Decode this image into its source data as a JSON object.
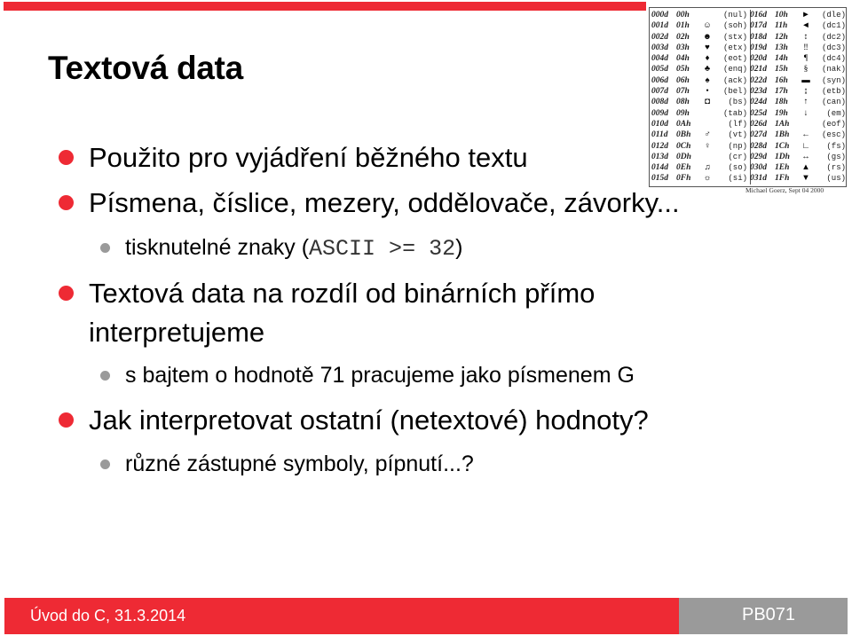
{
  "slide": {
    "title": "Textová data",
    "bullets": [
      {
        "text": "Použito pro vyjádření běžného textu"
      },
      {
        "text": "Písmena, číslice, mezery, oddělovače, závorky...",
        "sub": [
          {
            "prefix": "tisknutelné znaky (",
            "code": "ASCII >= 32",
            "suffix": ")"
          }
        ]
      },
      {
        "text_line1": "Textová data na rozdíl od binárních přímo",
        "text_line2": "interpretujeme",
        "sub": [
          {
            "text": "s bajtem o hodnotě 71 pracujeme jako písmenem G"
          }
        ]
      },
      {
        "text": "Jak interpretovat ostatní (netextové) hodnoty?",
        "sub": [
          {
            "text": "různé zástupné symboly, pípnutí...?"
          }
        ]
      }
    ]
  },
  "ascii_table": {
    "left": [
      {
        "dec": "000d",
        "hex": "00h",
        "sym": "",
        "name": "(nul)"
      },
      {
        "dec": "001d",
        "hex": "01h",
        "sym": "☺",
        "name": "(soh)"
      },
      {
        "dec": "002d",
        "hex": "02h",
        "sym": "☻",
        "name": "(stx)"
      },
      {
        "dec": "003d",
        "hex": "03h",
        "sym": "♥",
        "name": "(etx)"
      },
      {
        "dec": "004d",
        "hex": "04h",
        "sym": "♦",
        "name": "(eot)"
      },
      {
        "dec": "005d",
        "hex": "05h",
        "sym": "♣",
        "name": "(enq)"
      },
      {
        "dec": "006d",
        "hex": "06h",
        "sym": "♠",
        "name": "(ack)"
      },
      {
        "dec": "007d",
        "hex": "07h",
        "sym": "•",
        "name": "(bel)"
      },
      {
        "dec": "008d",
        "hex": "08h",
        "sym": "◘",
        "name": "(bs)"
      },
      {
        "dec": "009d",
        "hex": "09h",
        "sym": "",
        "name": "(tab)"
      },
      {
        "dec": "010d",
        "hex": "0Ah",
        "sym": "",
        "name": "(lf)"
      },
      {
        "dec": "011d",
        "hex": "0Bh",
        "sym": "♂",
        "name": "(vt)"
      },
      {
        "dec": "012d",
        "hex": "0Ch",
        "sym": "♀",
        "name": "(np)"
      },
      {
        "dec": "013d",
        "hex": "0Dh",
        "sym": "",
        "name": "(cr)"
      },
      {
        "dec": "014d",
        "hex": "0Eh",
        "sym": "♫",
        "name": "(so)"
      },
      {
        "dec": "015d",
        "hex": "0Fh",
        "sym": "☼",
        "name": "(si)"
      }
    ],
    "right": [
      {
        "dec": "016d",
        "hex": "10h",
        "sym": "►",
        "name": "(dle)"
      },
      {
        "dec": "017d",
        "hex": "11h",
        "sym": "◄",
        "name": "(dc1)"
      },
      {
        "dec": "018d",
        "hex": "12h",
        "sym": "↕",
        "name": "(dc2)"
      },
      {
        "dec": "019d",
        "hex": "13h",
        "sym": "‼",
        "name": "(dc3)"
      },
      {
        "dec": "020d",
        "hex": "14h",
        "sym": "¶",
        "name": "(dc4)"
      },
      {
        "dec": "021d",
        "hex": "15h",
        "sym": "§",
        "name": "(nak)"
      },
      {
        "dec": "022d",
        "hex": "16h",
        "sym": "▬",
        "name": "(syn)"
      },
      {
        "dec": "023d",
        "hex": "17h",
        "sym": "↨",
        "name": "(etb)"
      },
      {
        "dec": "024d",
        "hex": "18h",
        "sym": "↑",
        "name": "(can)"
      },
      {
        "dec": "025d",
        "hex": "19h",
        "sym": "↓",
        "name": "(em)"
      },
      {
        "dec": "026d",
        "hex": "1Ah",
        "sym": "",
        "name": "(eof)"
      },
      {
        "dec": "027d",
        "hex": "1Bh",
        "sym": "←",
        "name": "(esc)"
      },
      {
        "dec": "028d",
        "hex": "1Ch",
        "sym": "∟",
        "name": "(fs)"
      },
      {
        "dec": "029d",
        "hex": "1Dh",
        "sym": "↔",
        "name": "(gs)"
      },
      {
        "dec": "030d",
        "hex": "1Eh",
        "sym": "▲",
        "name": "(rs)"
      },
      {
        "dec": "031d",
        "hex": "1Fh",
        "sym": "▼",
        "name": "(us)"
      }
    ],
    "credit": "Michael Goerz, Sept 04 2000"
  },
  "footer": {
    "left_text": "Úvod do C, 31.3.2014",
    "right_text": "PB071"
  },
  "colors": {
    "accent_red": "#ee2a34",
    "footer_gray": "#9a9a9a",
    "sub_bullet_gray": "#9a9a9a"
  }
}
